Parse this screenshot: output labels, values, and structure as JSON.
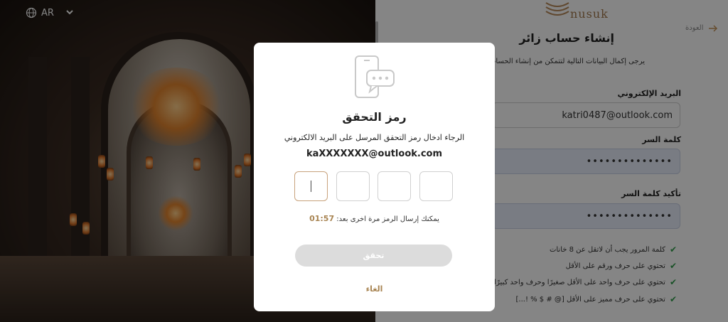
{
  "topbar": {
    "language": "AR"
  },
  "logo": {
    "wordmark": "nusuk"
  },
  "form": {
    "back_label": "العودة",
    "title": "إنشاء حساب زائر",
    "subtitle": "يرجى إكمال البيانات التالية لتتمكن من إنشاء الحساب",
    "email_label": "البريد الإلكتروني",
    "email_value": "katri0487@outlook.com",
    "password_label": "كلمة السر",
    "password_value": "••••••••••••••",
    "confirm_label": "تأكيد كلمة السر",
    "confirm_value": "••••••••••••••",
    "rules": [
      "كلمة المرور يجب أن لاتقل عن 8 خانات",
      "تحتوي على حرف ورقم على الأقل",
      "تحتوي على حرف واحد على الأقل صغيرًا وحرف واحد كبيرًا",
      "تحتوي على حرف مميز على الأقل [@ # $ % !...]"
    ]
  },
  "modal": {
    "title": "رمز التحقق",
    "description": "الرجاء ادخال رمز التحقق المرسل على البريد الالكتروني",
    "masked_email": "kaXXXXXXX@outlook.com",
    "resend_text": "يمكنك إرسال الرمز مرة اخرى بعد:",
    "timer": "01:57",
    "verify_label": "تحقق",
    "cancel_label": "الغاء"
  },
  "colors": {
    "accent": "#a88452",
    "success": "#2e9c4a",
    "disabled": "#dcdcdc"
  }
}
